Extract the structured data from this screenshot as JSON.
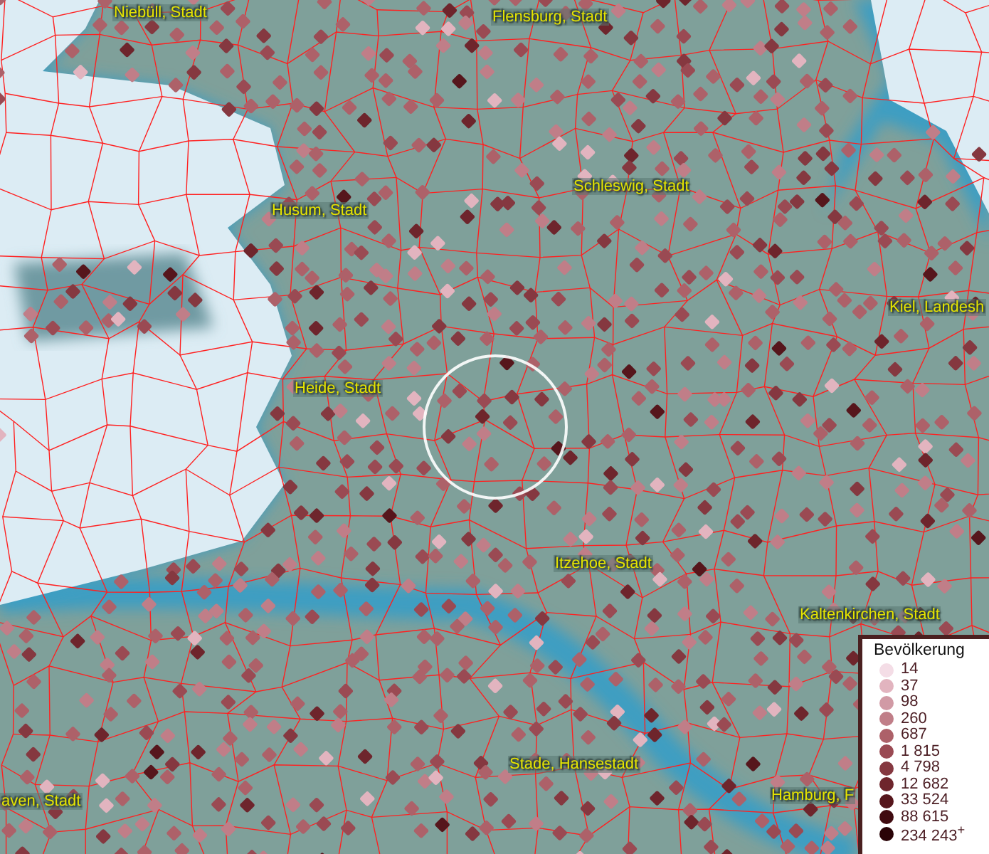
{
  "map": {
    "places": [
      {
        "name": "Niebüll, Stadt"
      },
      {
        "name": "Flensburg, Stadt"
      },
      {
        "name": "Schleswig, Stadt"
      },
      {
        "name": "Husum, Stadt"
      },
      {
        "name": "Kiel, Landesh"
      },
      {
        "name": "Heide, Stadt"
      },
      {
        "name": "Itzehoe, Stadt"
      },
      {
        "name": "Kaltenkirchen, Stadt"
      },
      {
        "name": "Stade, Hansestadt"
      },
      {
        "name": "Hamburg, F"
      },
      {
        "name": "aven, Stadt"
      }
    ]
  },
  "legend": {
    "title": "Bevölkerung",
    "items": [
      {
        "label": "14",
        "color": "#f4dde6"
      },
      {
        "label": "37",
        "color": "#e2b4bf"
      },
      {
        "label": "98",
        "color": "#d19aa5"
      },
      {
        "label": "260",
        "color": "#c07e88"
      },
      {
        "label": "687",
        "color": "#ad6169"
      },
      {
        "label": "1 815",
        "color": "#9a4a53"
      },
      {
        "label": "4 798",
        "color": "#853840"
      },
      {
        "label": "12 682",
        "color": "#6e252c"
      },
      {
        "label": "33 524",
        "color": "#56161c"
      },
      {
        "label": "88 615",
        "color": "#400b10"
      },
      {
        "label": "234 243$^{+}$",
        "color": "#2a0307"
      }
    ]
  }
}
